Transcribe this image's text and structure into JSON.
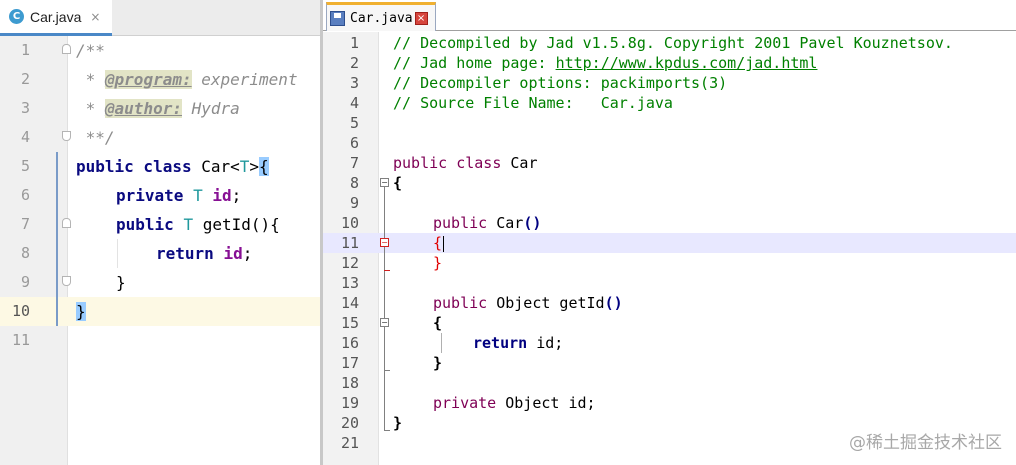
{
  "left": {
    "tab": {
      "icon_letter": "C",
      "label": "Car.java",
      "close": "×"
    },
    "lines": [
      {
        "num": "1"
      },
      {
        "num": "2"
      },
      {
        "num": "3"
      },
      {
        "num": "4"
      },
      {
        "num": "5"
      },
      {
        "num": "6"
      },
      {
        "num": "7"
      },
      {
        "num": "8"
      },
      {
        "num": "9"
      },
      {
        "num": "10"
      },
      {
        "num": "11"
      }
    ],
    "code": {
      "l1": "/**",
      "l2_star": " * ",
      "l2_tag": "@program:",
      "l2_text": " experiment",
      "l3_star": " * ",
      "l3_tag": "@author:",
      "l3_text": " Hydra",
      "l4": " **/",
      "l5_kw": "public class ",
      "l5_name": "Car<",
      "l5_t": "T",
      "l5_gt": ">",
      "l5_brace": "{",
      "l6_kw": "private ",
      "l6_t": "T ",
      "l6_id": "id",
      "l6_semi": ";",
      "l7_kw": "public ",
      "l7_t": "T ",
      "l7_rest": "getId(){",
      "l8_kw": "return ",
      "l8_id": "id",
      "l8_semi": ";",
      "l9": "}",
      "l10": "}"
    }
  },
  "right": {
    "tab": {
      "label": "Car.java",
      "close": "×"
    },
    "lines": [
      {
        "num": "1"
      },
      {
        "num": "2"
      },
      {
        "num": "3"
      },
      {
        "num": "4"
      },
      {
        "num": "5"
      },
      {
        "num": "6"
      },
      {
        "num": "7"
      },
      {
        "num": "8"
      },
      {
        "num": "9"
      },
      {
        "num": "10"
      },
      {
        "num": "11"
      },
      {
        "num": "12"
      },
      {
        "num": "13"
      },
      {
        "num": "14"
      },
      {
        "num": "15"
      },
      {
        "num": "16"
      },
      {
        "num": "17"
      },
      {
        "num": "18"
      },
      {
        "num": "19"
      },
      {
        "num": "20"
      },
      {
        "num": "21"
      }
    ],
    "code": {
      "r1": "// Decompiled by Jad v1.5.8g. Copyright 2001 Pavel Kouznetsov.",
      "r2_pre": "// Jad home page: ",
      "r2_link": "http://www.kpdus.com/jad.html",
      "r3": "// Decompiler options: packimports(3)",
      "r4": "// Source File Name:   Car.java",
      "r7_kw": "public class ",
      "r7_name": "Car",
      "r8": "{",
      "r10_kw": "public ",
      "r10_name": "Car",
      "r10_par": "()",
      "r11": "{",
      "r12": "}",
      "r14_kw": "public ",
      "r14_name": "Object getId",
      "r14_par": "()",
      "r15": "{",
      "r16_kw": "return ",
      "r16_rest": "id;",
      "r17": "}",
      "r19_kw": "private ",
      "r19_rest": "Object id;",
      "r20": "}"
    }
  },
  "watermark": "@稀土掘金技术社区"
}
